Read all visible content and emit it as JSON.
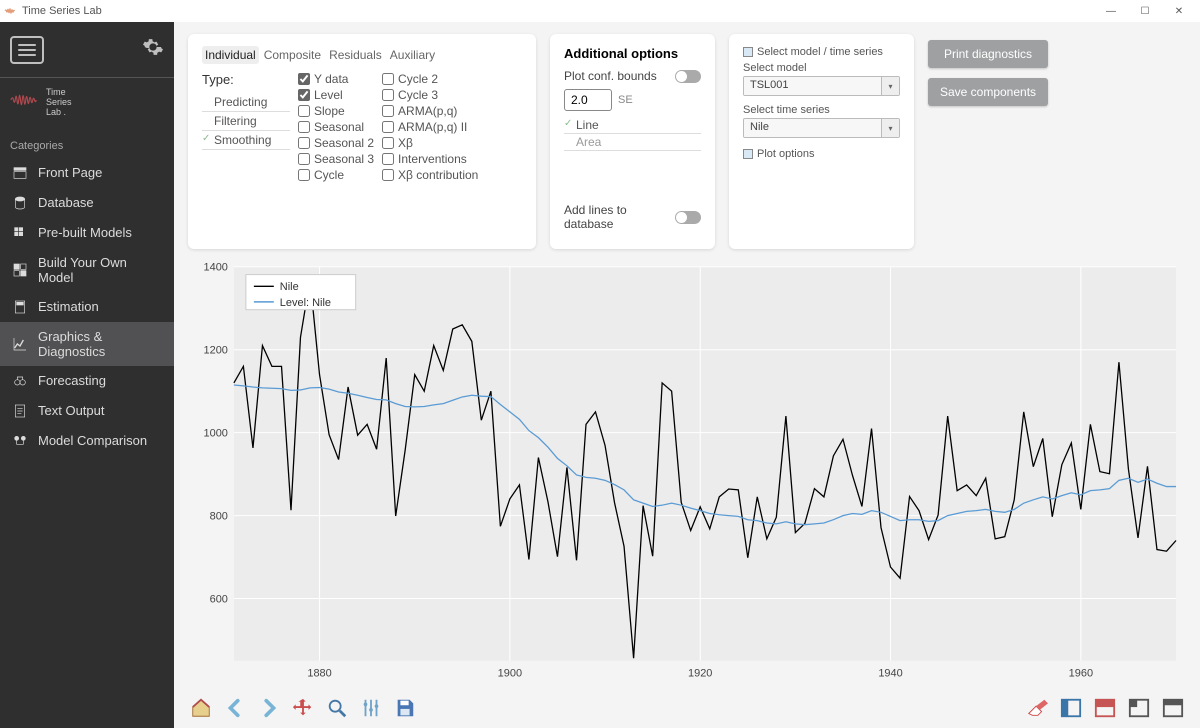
{
  "window": {
    "title": "Time Series Lab"
  },
  "brand": {
    "line1": "Time",
    "line2": "Series",
    "line3": "Lab ."
  },
  "categories_label": "Categories",
  "nav": [
    {
      "label": "Front Page",
      "icon": "layout"
    },
    {
      "label": "Database",
      "icon": "database"
    },
    {
      "label": "Pre-built Models",
      "icon": "grid"
    },
    {
      "label": "Build Your Own Model",
      "icon": "blocks"
    },
    {
      "label": "Estimation",
      "icon": "calc"
    },
    {
      "label": "Graphics & Diagnostics",
      "icon": "chart",
      "active": true
    },
    {
      "label": "Forecasting",
      "icon": "binoc"
    },
    {
      "label": "Text Output",
      "icon": "doc"
    },
    {
      "label": "Model Comparison",
      "icon": "compare"
    }
  ],
  "plottype": {
    "tabs": [
      "Individual",
      "Composite",
      "Residuals",
      "Auxiliary"
    ],
    "active_tab": "Individual",
    "type_label": "Type:",
    "types": [
      "Predicting",
      "Filtering",
      "Smoothing"
    ],
    "selected_type": "Smoothing",
    "col1": [
      {
        "label": "Y data",
        "checked": true
      },
      {
        "label": "Level",
        "checked": true
      },
      {
        "label": "Slope",
        "checked": false
      },
      {
        "label": "Seasonal",
        "checked": false
      },
      {
        "label": "Seasonal 2",
        "checked": false
      },
      {
        "label": "Seasonal 3",
        "checked": false
      },
      {
        "label": "Cycle",
        "checked": false
      }
    ],
    "col2": [
      {
        "label": "Cycle 2",
        "checked": false
      },
      {
        "label": "Cycle 3",
        "checked": false
      },
      {
        "label": "ARMA(p,q)",
        "checked": false
      },
      {
        "label": "ARMA(p,q) II",
        "checked": false
      },
      {
        "label": "Xβ",
        "checked": false
      },
      {
        "label": "Interventions",
        "checked": false
      },
      {
        "label": "Xβ contribution",
        "checked": false
      }
    ]
  },
  "additional": {
    "title": "Additional options",
    "plot_conf_label": "Plot conf. bounds",
    "conf_value": "2.0",
    "se_label": "SE",
    "line_label": "Line",
    "area_label": "Area",
    "add_lines_label": "Add lines to database"
  },
  "selectpanel": {
    "title": "Select model / time series",
    "model_label": "Select model",
    "model_value": "TSL001",
    "series_label": "Select time series",
    "series_value": "Nile",
    "plot_opts_label": "Plot options"
  },
  "buttons": {
    "print": "Print diagnostics",
    "save": "Save components"
  },
  "chart_data": {
    "type": "line",
    "xlabel": "",
    "ylabel": "",
    "x_start": 1871,
    "x_end": 1970,
    "x_ticks": [
      1880,
      1900,
      1920,
      1940,
      1960
    ],
    "y_ticks": [
      600,
      800,
      1000,
      1200,
      1400
    ],
    "ylim": [
      450,
      1400
    ],
    "legend": [
      "Nile",
      "Level: Nile"
    ],
    "series": [
      {
        "name": "Nile",
        "color": "#000000",
        "values": [
          1120,
          1160,
          963,
          1210,
          1160,
          1160,
          813,
          1230,
          1370,
          1140,
          995,
          935,
          1110,
          994,
          1020,
          960,
          1180,
          799,
          958,
          1140,
          1100,
          1210,
          1150,
          1250,
          1260,
          1220,
          1030,
          1100,
          774,
          840,
          874,
          694,
          940,
          833,
          701,
          916,
          692,
          1020,
          1050,
          969,
          831,
          726,
          456,
          824,
          702,
          1120,
          1100,
          832,
          764,
          821,
          768,
          845,
          864,
          862,
          698,
          845,
          744,
          796,
          1040,
          759,
          781,
          865,
          845,
          944,
          984,
          897,
          822,
          1010,
          771,
          676,
          649,
          846,
          812,
          742,
          801,
          1040,
          860,
          874,
          848,
          890,
          744,
          749,
          838,
          1050,
          918,
          986,
          797,
          923,
          975,
          815,
          1020,
          906,
          901,
          1170,
          912,
          746,
          919,
          718,
          714,
          740
        ]
      },
      {
        "name": "Level: Nile",
        "color": "#5a9bd4",
        "values": [
          1115,
          1113,
          1110,
          1108,
          1107,
          1106,
          1102,
          1103,
          1108,
          1109,
          1105,
          1098,
          1095,
          1090,
          1085,
          1080,
          1079,
          1070,
          1063,
          1062,
          1063,
          1067,
          1070,
          1078,
          1086,
          1090,
          1088,
          1087,
          1068,
          1050,
          1032,
          1005,
          988,
          965,
          938,
          920,
          898,
          892,
          890,
          885,
          875,
          862,
          838,
          830,
          822,
          825,
          830,
          825,
          818,
          812,
          805,
          802,
          800,
          798,
          790,
          788,
          782,
          780,
          785,
          780,
          778,
          780,
          782,
          790,
          800,
          805,
          803,
          812,
          808,
          798,
          788,
          790,
          790,
          786,
          788,
          800,
          805,
          810,
          812,
          815,
          810,
          808,
          815,
          830,
          838,
          845,
          840,
          848,
          855,
          850,
          860,
          862,
          865,
          885,
          890,
          880,
          888,
          878,
          870,
          870
        ]
      }
    ]
  }
}
